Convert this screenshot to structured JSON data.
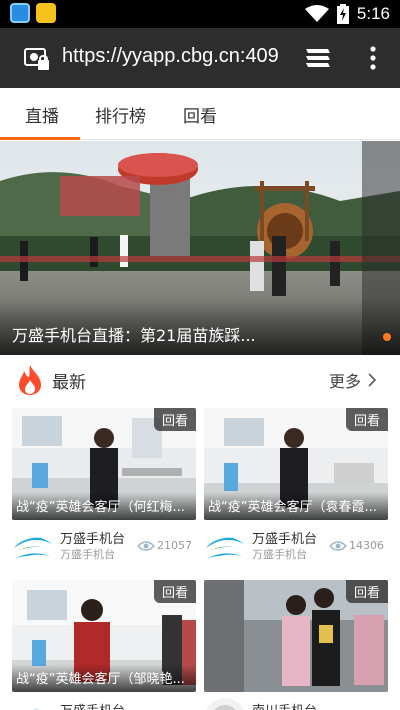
{
  "status_bar": {
    "time": "5:16",
    "icons": [
      "app-notification-icon",
      "shopping-bag-icon",
      "wifi-icon",
      "battery-charging-icon"
    ]
  },
  "url_bar": {
    "url": "https://yyapp.cbg.cn:409",
    "icons": [
      "site-info-icon",
      "tabs-icon",
      "overflow-menu-icon"
    ]
  },
  "tabs": [
    {
      "label": "直播",
      "active": true
    },
    {
      "label": "排行榜",
      "active": false
    },
    {
      "label": "回看",
      "active": false
    }
  ],
  "banner": {
    "title": "万盛手机台直播：第21届苗族踩..."
  },
  "section": {
    "title": "最新",
    "more": "更多",
    "icon": "fire-icon"
  },
  "cards": [
    {
      "badge": "回看",
      "title": "战“疫”英雄会客厅（何红梅...",
      "channel": "万盛手机台",
      "sub": "万盛手机台",
      "views": "21057"
    },
    {
      "badge": "回看",
      "title": "战“疫”英雄会客厅（袁春霞...",
      "channel": "万盛手机台",
      "sub": "万盛手机台",
      "views": "14306"
    },
    {
      "badge": "回看",
      "title": "战“疫”英雄会客厅（邹晓艳...",
      "channel": "万盛手机台",
      "sub": "",
      "views": ""
    },
    {
      "badge": "回看",
      "title": "",
      "channel": "南川手机台",
      "sub": "",
      "views": ""
    }
  ],
  "colors": {
    "accent": "#ff6a10",
    "urlbar": "#2d2d2d",
    "statusbar": "#000000"
  }
}
